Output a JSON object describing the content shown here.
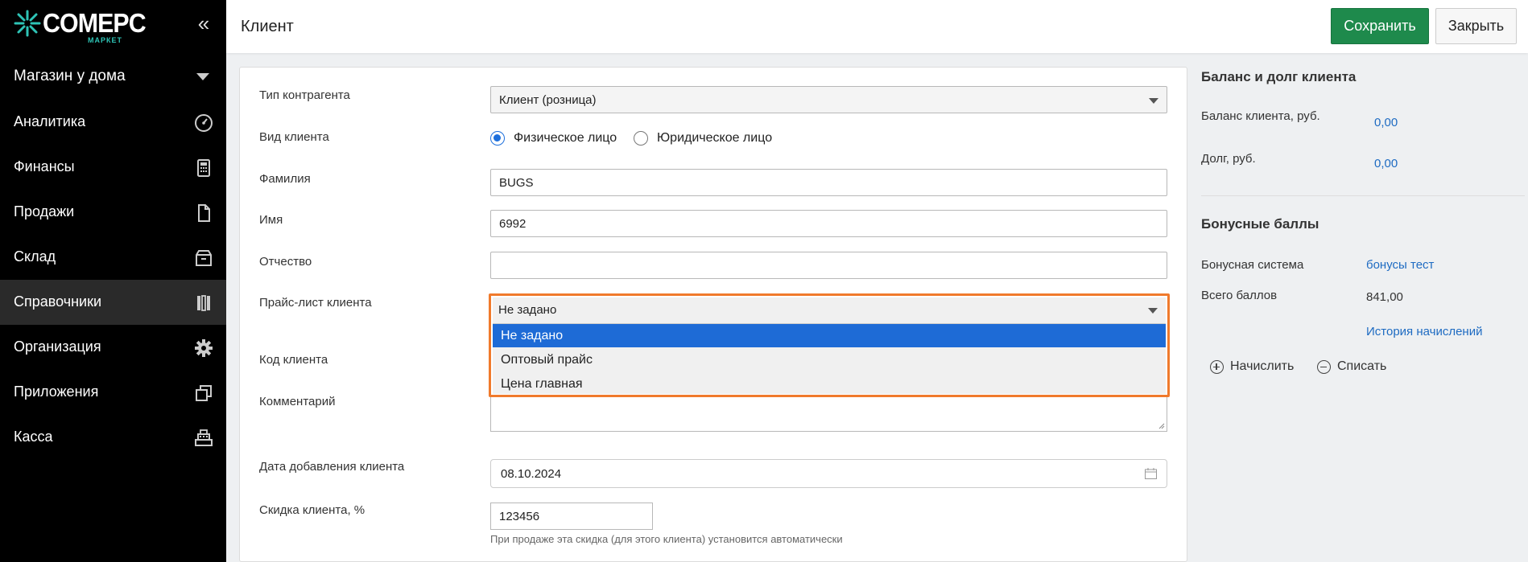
{
  "sidebar": {
    "logo": {
      "brand": "COMEPC",
      "sub": "МАРКЕТ"
    },
    "store": "Магазин у дома",
    "items": [
      {
        "label": "Аналитика",
        "icon": "speedometer-icon"
      },
      {
        "label": "Финансы",
        "icon": "calculator-icon"
      },
      {
        "label": "Продажи",
        "icon": "document-icon"
      },
      {
        "label": "Склад",
        "icon": "box-icon"
      },
      {
        "label": "Справочники",
        "icon": "books-icon",
        "active": true
      },
      {
        "label": "Организация",
        "icon": "gear-icon"
      },
      {
        "label": "Приложения",
        "icon": "windows-icon"
      },
      {
        "label": "Касса",
        "icon": "cash-register-icon"
      }
    ]
  },
  "header": {
    "title": "Клиент",
    "save_label": "Сохранить",
    "close_label": "Закрыть"
  },
  "form": {
    "contractor_type": {
      "label": "Тип контрагента",
      "value": "Клиент (розница)"
    },
    "client_kind": {
      "label": "Вид клиента",
      "options": [
        "Физическое лицо",
        "Юридическое лицо"
      ],
      "selected": "Физическое лицо"
    },
    "last_name": {
      "label": "Фамилия",
      "value": "BUGS"
    },
    "first_name": {
      "label": "Имя",
      "value": "6992"
    },
    "middle_name": {
      "label": "Отчество",
      "value": ""
    },
    "price_list": {
      "label": "Прайс-лист клиента",
      "value": "Не задано",
      "options": [
        "Не задано",
        "Оптовый прайс",
        "Цена главная"
      ],
      "highlight_color": "#f07a2c"
    },
    "client_code": {
      "label": "Код клиента"
    },
    "comment": {
      "label": "Комментарий"
    },
    "date_added": {
      "label": "Дата добавления клиента",
      "value": "08.10.2024"
    },
    "discount": {
      "label": "Скидка клиента, %",
      "value": "123456",
      "hint": "При продаже эта скидка (для этого клиента) установится автоматически"
    }
  },
  "balance": {
    "heading": "Баланс и долг клиента",
    "balance_label": "Баланс клиента, руб.",
    "balance_value": "0,00",
    "debt_label": "Долг, руб.",
    "debt_value": "0,00"
  },
  "bonus": {
    "heading": "Бонусные баллы",
    "system_label": "Бонусная система",
    "system_value": "бонусы тест",
    "total_label": "Всего баллов",
    "total_value": "841,00",
    "history_link": "История начислений",
    "accrue_label": "Начислить",
    "writeoff_label": "Списать"
  },
  "colors": {
    "sidebar_bg": "#000000",
    "save_green": "#1e8a4c",
    "selected_blue": "#1e6bd6",
    "link_blue": "#1e6bc2"
  }
}
